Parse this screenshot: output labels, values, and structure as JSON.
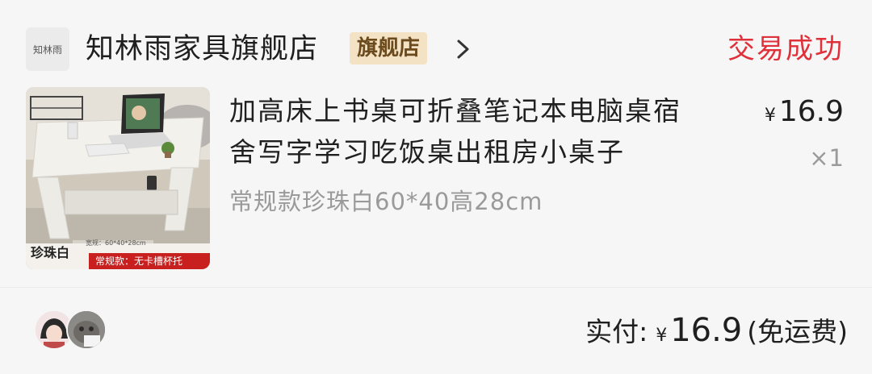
{
  "shop": {
    "logo_text": "知林雨",
    "name": "知林雨家具旗舰店",
    "badge": "旗舰店"
  },
  "order": {
    "status": "交易成功",
    "status_color": "#e0303a"
  },
  "item": {
    "title_line1": "加高床上书桌可折叠笔记本电脑桌宿",
    "title_line2": "舍写字学习吃饭桌出租房小桌子",
    "sku": "常规款珍珠白60*40高28cm",
    "currency": "¥",
    "price": "16.9",
    "quantity": "×1",
    "thumb_label": "珍珠白",
    "thumb_tag": "常规款：无卡槽杯托",
    "thumb_size_note": "宽规：60*40*28cm"
  },
  "footer": {
    "paid_label": "实付:",
    "currency": "¥",
    "paid_amount": "16.9",
    "shipping_note": "(免运费)"
  }
}
